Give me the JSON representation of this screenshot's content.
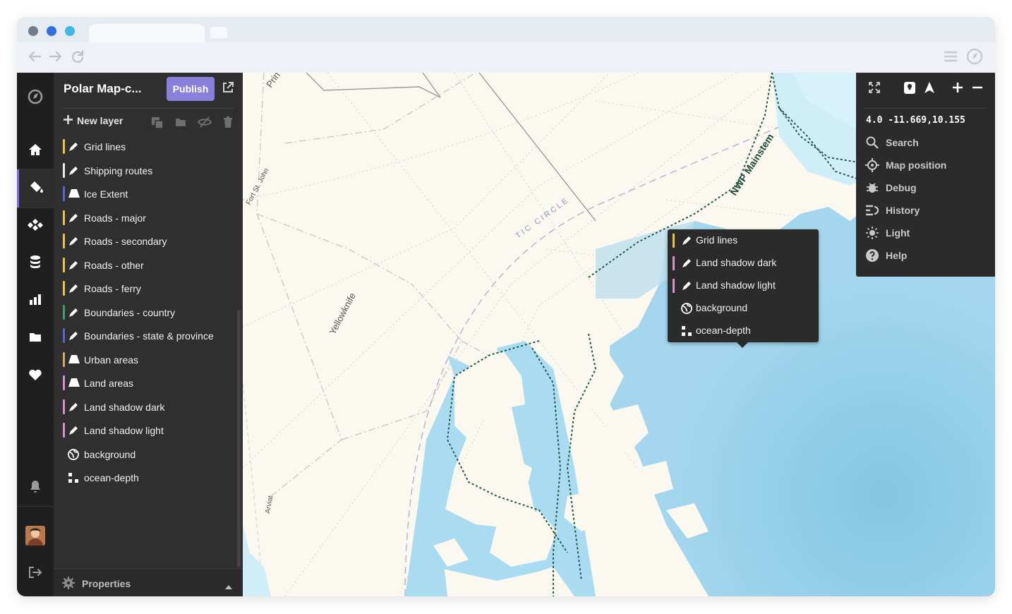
{
  "browser": {
    "dot_colors": [
      "#6f7d8c",
      "#2f6fe0",
      "#3fb6e8"
    ]
  },
  "rail": {
    "items": [
      "compass-icon",
      "home-icon",
      "paint-bucket-icon",
      "layers-diamond-icon",
      "database-icon",
      "chart-icon",
      "folder-icon",
      "heart-icon"
    ],
    "active": "paint-bucket-icon",
    "bottom": [
      "bell-icon",
      "avatar",
      "logout-icon"
    ]
  },
  "panel": {
    "title": "Polar Map-c...",
    "publish_label": "Publish",
    "new_layer_label": "New layer",
    "properties_label": "Properties",
    "layers": [
      {
        "name": "Grid lines",
        "type": "line",
        "color": "#e8c43a"
      },
      {
        "name": "Shipping routes",
        "type": "line",
        "color": "#e9e9e9"
      },
      {
        "name": "Ice Extent",
        "type": "fill",
        "color": "#5b63d6"
      },
      {
        "name": "Roads - major",
        "type": "line",
        "color": "#e8c43a"
      },
      {
        "name": "Roads - secondary",
        "type": "line",
        "color": "#e8c43a"
      },
      {
        "name": "Roads - other",
        "type": "line",
        "color": "#e8c43a"
      },
      {
        "name": "Roads - ferry",
        "type": "line",
        "color": "#e8c43a"
      },
      {
        "name": "Boundaries - country",
        "type": "line",
        "color": "#3ea06e"
      },
      {
        "name": "Boundaries - state & province",
        "type": "line",
        "color": "#5b63d6"
      },
      {
        "name": "Urban areas",
        "type": "fill",
        "color": "#d9a56a"
      },
      {
        "name": "Land areas",
        "type": "fill",
        "color": "#d98fc7"
      },
      {
        "name": "Land shadow dark",
        "type": "line",
        "color": "#d98fc7"
      },
      {
        "name": "Land shadow light",
        "type": "line",
        "color": "#d98fc7"
      },
      {
        "name": "background",
        "type": "background",
        "color": ""
      },
      {
        "name": "ocean-depth",
        "type": "raster",
        "color": ""
      }
    ]
  },
  "map": {
    "labels": {
      "prin": "Prin",
      "fort_st_john": "Fort St. John",
      "yellowknife": "Yellowknife",
      "arctic_circle": "TIC CIRCLE",
      "nwp_mainstem": "NWP Mainstem",
      "arviat": "Arviat"
    },
    "colors": {
      "land": "#fbf8ef",
      "water_shallow": "#cfeef8",
      "water_deep": "#8ccbe6",
      "route": "#1e5b4a"
    }
  },
  "popup": {
    "items": [
      {
        "name": "Grid lines",
        "type": "line",
        "color": "#e8c43a"
      },
      {
        "name": "Land shadow dark",
        "type": "line",
        "color": "#d98fc7"
      },
      {
        "name": "Land shadow light",
        "type": "line",
        "color": "#d98fc7"
      },
      {
        "name": "background",
        "type": "background",
        "color": ""
      },
      {
        "name": "ocean-depth",
        "type": "raster",
        "color": ""
      }
    ]
  },
  "map_controls": {
    "coords": "4.0 -11.669,10.155",
    "menu": [
      {
        "label": "Search",
        "icon": "search-icon"
      },
      {
        "label": "Map position",
        "icon": "crosshair-icon"
      },
      {
        "label": "Debug",
        "icon": "bug-icon"
      },
      {
        "label": "History",
        "icon": "history-icon"
      },
      {
        "label": "Light",
        "icon": "sun-icon"
      },
      {
        "label": "Help",
        "icon": "help-icon"
      }
    ]
  }
}
